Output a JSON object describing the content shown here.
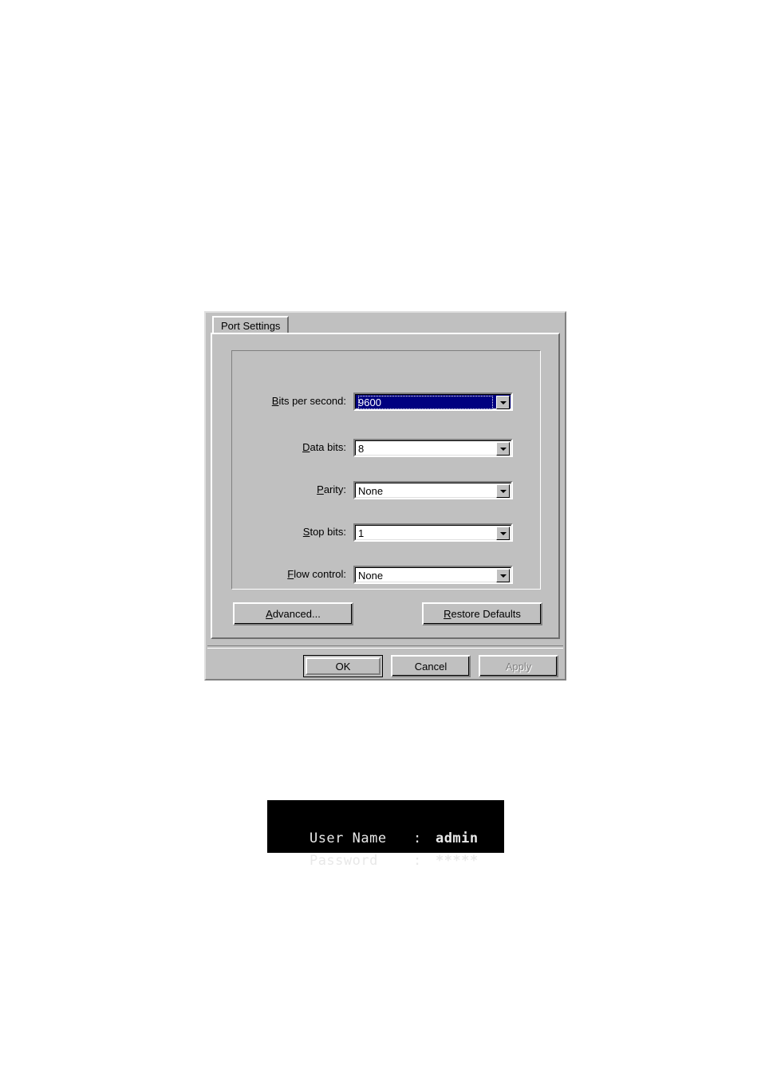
{
  "dialog": {
    "tab": {
      "label": "Port Settings"
    },
    "fields": [
      {
        "label_pre": "",
        "label_accel": "B",
        "label_post": "its per second:",
        "value": "9600",
        "selected": true,
        "name": "bits-per-second"
      },
      {
        "label_pre": "",
        "label_accel": "D",
        "label_post": "ata bits:",
        "value": "8",
        "selected": false,
        "name": "data-bits"
      },
      {
        "label_pre": "",
        "label_accel": "P",
        "label_post": "arity:",
        "value": "None",
        "selected": false,
        "name": "parity"
      },
      {
        "label_pre": "",
        "label_accel": "S",
        "label_post": "top bits:",
        "value": "1",
        "selected": false,
        "name": "stop-bits"
      },
      {
        "label_pre": "",
        "label_accel": "F",
        "label_post": "low control:",
        "value": "None",
        "selected": false,
        "name": "flow-control"
      }
    ],
    "buttons": {
      "advanced": {
        "accel": "A",
        "rest": "dvanced..."
      },
      "restore_defaults": {
        "accel": "R",
        "rest": "estore Defaults"
      },
      "ok": "OK",
      "cancel": "Cancel",
      "apply": "Apply"
    },
    "colors": {
      "face": "#c0c0c0",
      "selection": "#000080",
      "selection_text": "#ffffff",
      "disabled_text": "#808080"
    }
  },
  "terminal": {
    "lines": [
      {
        "label": "User Name",
        "colon": ":",
        "value": "admin"
      },
      {
        "label": "Password",
        "colon": ":",
        "value": "*****"
      }
    ],
    "colors": {
      "background": "#000000",
      "text": "#e8e8e8"
    }
  }
}
